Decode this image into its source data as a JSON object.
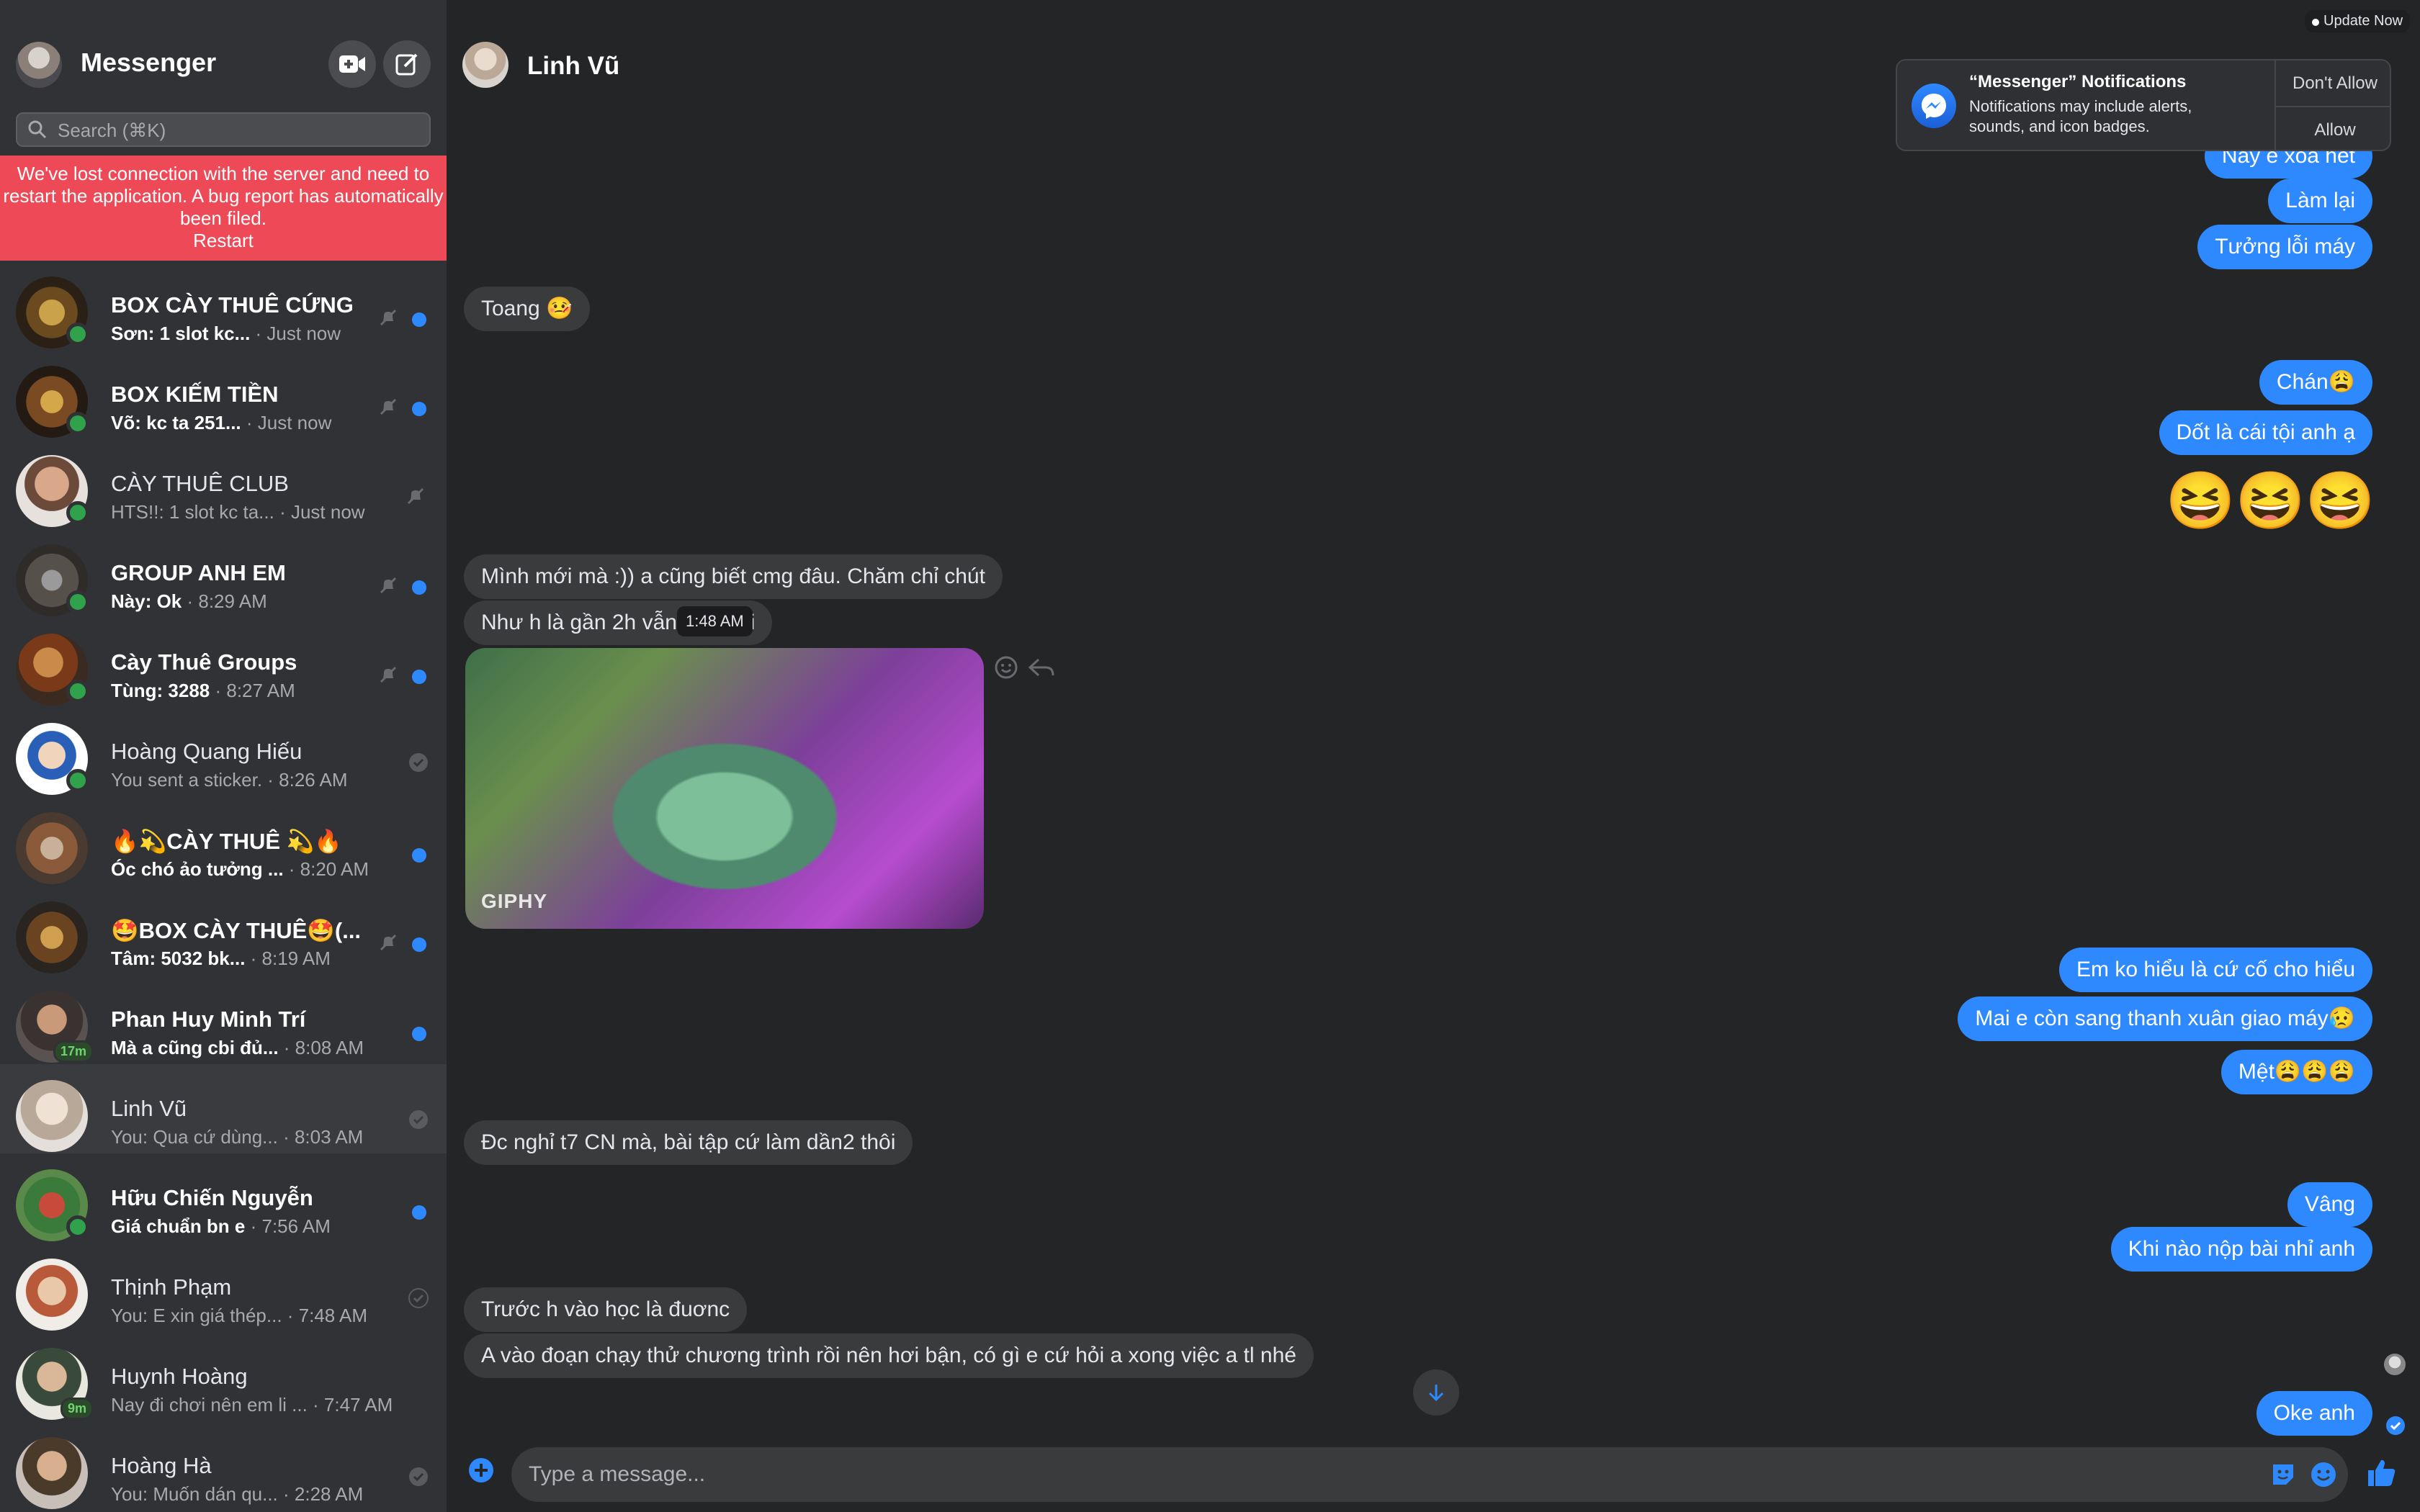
{
  "app": {
    "title": "Messenger"
  },
  "search": {
    "placeholder": "Search (⌘K)"
  },
  "error_banner": {
    "message": "We've lost connection with the server and need to restart the application. A bug report has automatically been filed.",
    "restart_label": "Restart"
  },
  "conversations": [
    {
      "name": "BOX CÀY THUÊ CỨNG",
      "preview": "Sơn: 1 slot kc...",
      "time": " · Just now",
      "unread": true,
      "muted": true,
      "online": true
    },
    {
      "name": "BOX KIẾM TIỀN",
      "preview": "Võ: kc ta 251...",
      "time": " · Just now",
      "unread": true,
      "muted": true,
      "online": true
    },
    {
      "name": "CÀY THUÊ CLUB",
      "preview": "HTS!!: 1 slot kc ta...",
      "time": " · Just now",
      "unread": false,
      "muted": true,
      "online": true
    },
    {
      "name": "GROUP ANH EM",
      "preview": "Này: Ok",
      "time": " · 8:29 AM",
      "unread": true,
      "muted": true,
      "online": true
    },
    {
      "name": "Cày Thuê Groups",
      "preview": "Tùng: 3288",
      "time": " · 8:27 AM",
      "unread": true,
      "muted": true,
      "online": true
    },
    {
      "name": "Hoàng Quang Hiếu",
      "preview": "You sent a sticker.",
      "time": " · 8:26 AM",
      "unread": false,
      "muted": false,
      "online": true
    },
    {
      "name": "🔥💫CÀY THUÊ 💫🔥",
      "preview": "Óc chó ảo tưởng ...",
      "time": " · 8:20 AM",
      "unread": true,
      "muted": false,
      "online": false
    },
    {
      "name": "🤩BOX CÀY THUÊ🤩(...",
      "preview": "Tâm: 5032 bk...",
      "time": " · 8:19 AM",
      "unread": true,
      "muted": true,
      "online": false
    },
    {
      "name": "Phan Huy Minh Trí",
      "preview": "Mà a cũng cbi đủ...",
      "time": " · 8:08 AM",
      "unread": true,
      "muted": false,
      "online": false,
      "active_ago": "17m"
    },
    {
      "name": "Linh Vũ",
      "preview": "You: Qua cứ dùng...",
      "time": " · 8:03 AM",
      "unread": false,
      "muted": false,
      "online": false,
      "active": true
    },
    {
      "name": "Hữu Chiến Nguyễn",
      "preview": "Giá chuẩn bn e",
      "time": " · 7:56 AM",
      "unread": true,
      "muted": false,
      "online": true
    },
    {
      "name": "Thịnh Phạm",
      "preview": "You: E xin giá thép...",
      "time": " · 7:48 AM",
      "unread": false,
      "muted": false,
      "online": false
    },
    {
      "name": "Huynh Hoàng",
      "preview": "Nay đi chơi nên em li ...",
      "time": " · 7:47 AM",
      "unread": false,
      "muted": false,
      "online": false,
      "active_ago": "9m"
    },
    {
      "name": "Hoàng Hà",
      "preview": "You: Muốn dán qu...",
      "time": " · 2:28 AM",
      "unread": false,
      "muted": false,
      "online": false
    }
  ],
  "chat": {
    "peer_name": "Linh Vũ",
    "messages": {
      "out_1": "Nay e xóa hết",
      "out_2": "Làm lại",
      "out_3": "Tưởng lỗi máy",
      "in_1": "Toang 🤒",
      "out_4": "Chán😩",
      "out_5": "Dốt là cái tội anh ạ",
      "out_6": "😆😆😆",
      "in_2": "Mình mới mà :)) a cũng biết cmg đâu. Chăm chỉ chút",
      "in_3": "Như h là gần 2h vẫn                  hăm rồi",
      "tooltip_time": "1:48 AM",
      "gif_label": "GIPHY",
      "out_7": "Em ko hiểu là cứ cố cho hiểu",
      "out_8": "Mai e còn sang thanh xuân giao máy😥",
      "out_9": "Mệt😩😩😩",
      "in_4": "Đc nghỉ t7 CN mà, bài tập cứ làm dần2 thôi",
      "out_10": "Vâng",
      "out_11": "Khi nào nộp bài nhỉ anh",
      "in_5": "Trước h vào học là đuơnc",
      "in_6": "A vào đoạn chạy thử chương trình rồi nên hơi bận, có gì e cứ hỏi a xong việc a tl nhé",
      "out_12": "Oke anh"
    }
  },
  "composer": {
    "placeholder": "Type a message..."
  },
  "notification": {
    "title": "“Messenger” Notifications",
    "body": "Notifications may include alerts, sounds, and icon badges.",
    "dont_allow": "Don't Allow",
    "allow": "Allow"
  },
  "update_now": "Update Now",
  "colors": {
    "accent": "#2e89ff",
    "error": "#ed4956",
    "online": "#31a24c"
  }
}
